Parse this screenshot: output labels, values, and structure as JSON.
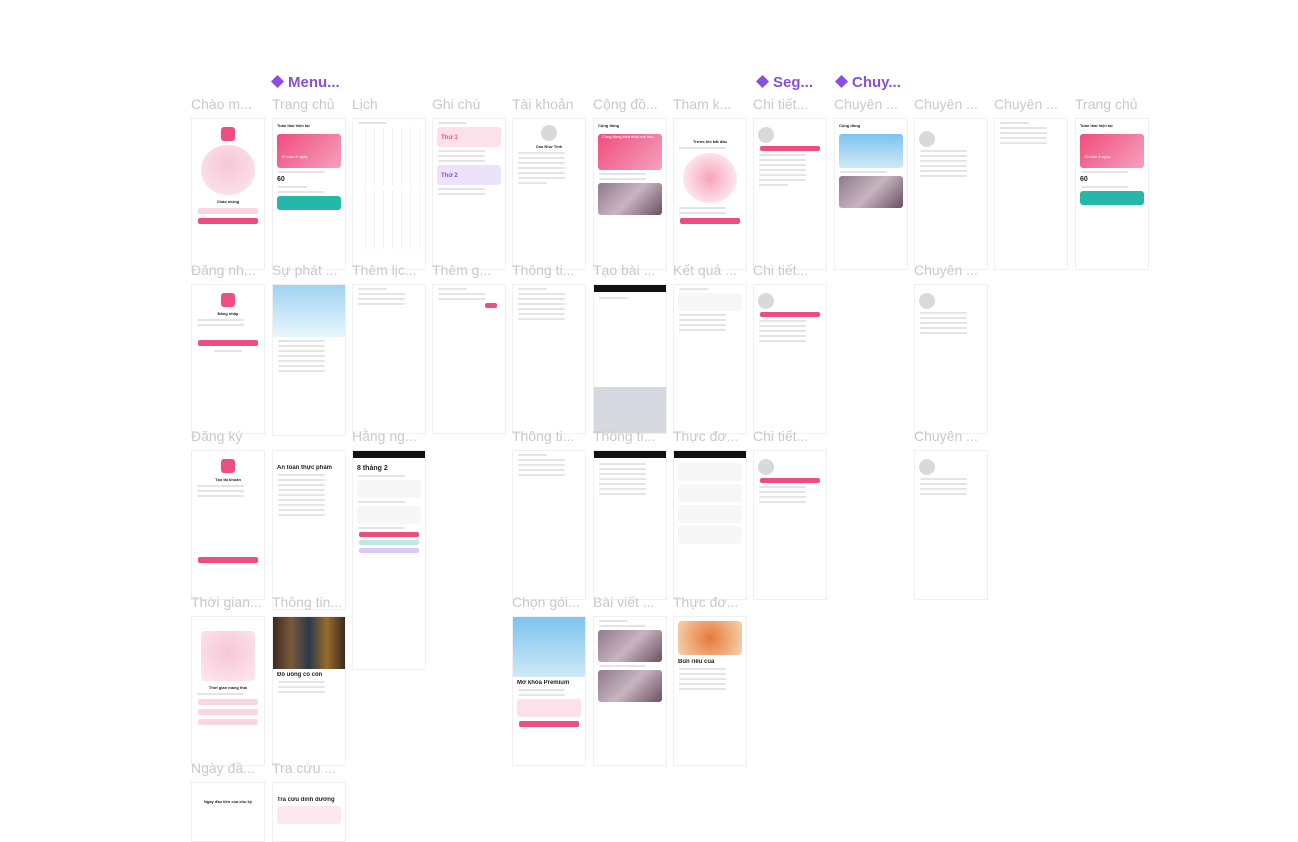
{
  "groups": [
    "Menu...",
    "Seg...",
    "Chuy..."
  ],
  "labels": {
    "r1": [
      "Chào m...",
      "Trang chủ",
      "Lịch",
      "Ghi chú",
      "Tài khoản",
      "Cộng đồ...",
      "Tham k...",
      "Chi tiết...",
      "Chuyên ...",
      "Chuyên ...",
      "Chuyên ...",
      "Trang chủ"
    ],
    "r2": [
      "Đăng nh...",
      "Sự phát ...",
      "Thêm lịc...",
      "Thêm g...",
      "Thông ti...",
      "Tạo bài ...",
      "Kết quả ...",
      "Chi tiết...",
      "Chuyên ..."
    ],
    "r3": [
      "Đăng ký",
      "Hằng ng...",
      "Thông ti...",
      "Thông ti...",
      "Thực đơ...",
      "Chi tiết...",
      "Chuyên ..."
    ],
    "r4": [
      "Thời gian...",
      "Thông tin...",
      "Chọn gói...",
      "Bài viết ...",
      "Thực đơ..."
    ],
    "r5": [
      "Ngày đầ...",
      "Tra cứu ..."
    ]
  },
  "screens": {
    "welcome": "Chào mừng",
    "login": "Đăng nhập",
    "register": "Tạo tài khoản",
    "pregnancy_time": "Thời gian mang thai",
    "first_day": "Ngày đầu tiên của chu kỳ",
    "home_title": "Tuần thai hiện tại",
    "home_week": "10 tuần 6 ngày",
    "home_weight": "60",
    "community": "Cộng đồng",
    "community_banner": "Cộng đồng kiến thức mẹ bầu",
    "account_name": "Cao Như Tình",
    "note_1": "Thứ 1",
    "note_2": "Thứ 2",
    "before_start": "Trước khi bắt đầu",
    "daily_date": "8 tháng 2",
    "food_safety": "An toàn thực phẩm",
    "alcohol": "Đồ uống có cồn",
    "premium": "Mở khóa Premium",
    "food_dish": "Bún riêu cua",
    "lookup": "Tra cứu dinh dưỡng"
  },
  "colors": {
    "accent": "#ec4f7f",
    "group_label": "#8a4fdc",
    "caption": "#c9c9c9",
    "teal": "#25b7a8"
  }
}
